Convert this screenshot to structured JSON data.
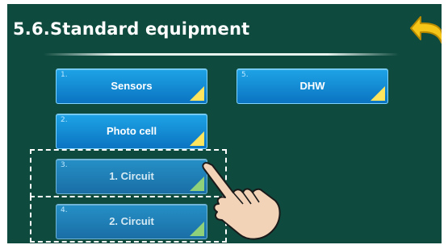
{
  "header": {
    "title": "5.6.Standard equipment"
  },
  "buttons": [
    {
      "num": "1.",
      "label": "Sensors"
    },
    {
      "num": "5.",
      "label": "DHW"
    },
    {
      "num": "2.",
      "label": "Photo cell"
    },
    {
      "num": "3.",
      "label": "1. Circuit"
    },
    {
      "num": "4.",
      "label": "2. Circuit"
    }
  ],
  "icons": {
    "back": "back-arrow-icon",
    "pointer": "hand-pointer-icon",
    "corner": "corner-triangle-icon"
  },
  "colors": {
    "background": "#0f4a3e",
    "button": "#1189d6",
    "corner": "#ffe45e",
    "back_arrow": "#f5c518"
  }
}
